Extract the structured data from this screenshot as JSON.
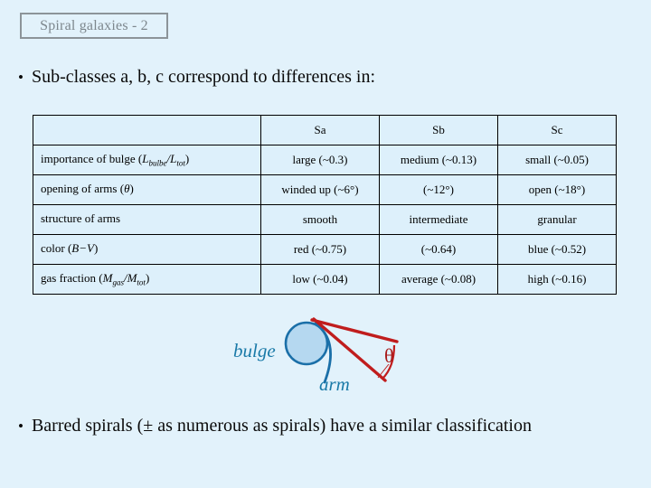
{
  "slide": {
    "background_color": "#e2f2fb",
    "title": "Spiral galaxies - 2",
    "title_border_color": "#8c9499",
    "title_text_color": "#7d878d"
  },
  "bullets": {
    "marker": "•",
    "top": "Sub-classes a, b, c correspond to differences in:",
    "bottom": "Barred spirals (± as numerous as spirals) have a similar classification"
  },
  "table": {
    "headers": [
      "",
      "Sa",
      "Sb",
      "Sc"
    ],
    "rows": [
      {
        "label_prefix": "importance of bulge (",
        "label_math_1": "L",
        "label_sub_1": "bulbe",
        "label_mid": "/",
        "label_math_2": "L",
        "label_sub_2": "tot",
        "label_suffix": ")",
        "values": [
          "large (~0.3)",
          "medium (~0.13)",
          "small (~0.05)"
        ]
      },
      {
        "label_prefix": "opening of arms (",
        "label_math_1": "θ",
        "label_sub_1": "",
        "label_mid": "",
        "label_math_2": "",
        "label_sub_2": "",
        "label_suffix": ")",
        "values": [
          "winded up (~6°)",
          "(~12°)",
          "open (~18°)"
        ]
      },
      {
        "label_prefix": "structure of arms",
        "label_math_1": "",
        "label_sub_1": "",
        "label_mid": "",
        "label_math_2": "",
        "label_sub_2": "",
        "label_suffix": "",
        "values": [
          "smooth",
          "intermediate",
          "granular"
        ]
      },
      {
        "label_prefix": "color  (",
        "label_math_1": "B−V",
        "label_sub_1": "",
        "label_mid": "",
        "label_math_2": "",
        "label_sub_2": "",
        "label_suffix": ")",
        "values": [
          "red (~0.75)",
          "(~0.64)",
          "blue (~0.52)"
        ]
      },
      {
        "label_prefix": "gas fraction (",
        "label_math_1": "M",
        "label_sub_1": "gas",
        "label_mid": "/",
        "label_math_2": "M",
        "label_sub_2": "tot",
        "label_suffix": ")",
        "values": [
          "low (~0.04)",
          "average (~0.08)",
          "high (~0.16)"
        ]
      }
    ]
  },
  "diagram": {
    "bulge_label": "bulge",
    "arm_label": "arm",
    "angle_label": "θ",
    "bulge_fill_color": "#b5d8f0",
    "bulge_stroke_color": "#1a6fa8",
    "arm_color": "#1a6fa8",
    "angle_color": "#c01d1d",
    "label_color": "#1a7aa8"
  }
}
